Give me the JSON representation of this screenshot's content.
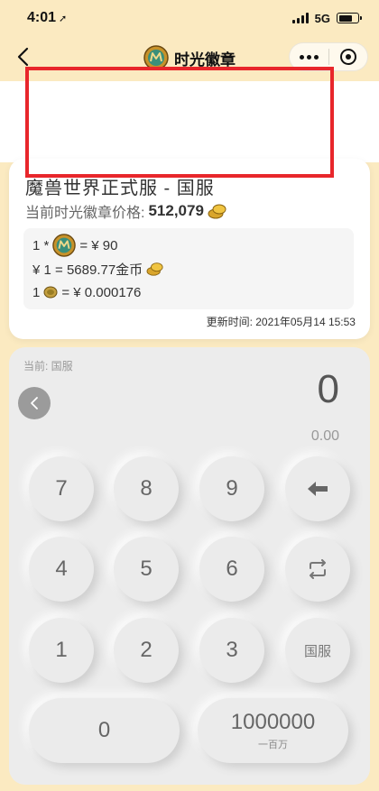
{
  "status_bar": {
    "time": "4:01",
    "network": "5G"
  },
  "nav": {
    "title": "时光徽章"
  },
  "price_card": {
    "server_name": "魔兽世界正式服 - 国服",
    "price_label": "当前时光徽章价格:",
    "price_value": "512,079",
    "rate1_prefix": "1 *",
    "rate1_value": "= ¥ 90",
    "rate2": "¥ 1 = 5689.77金币",
    "rate3_prefix": "1",
    "rate3_value": "= ¥ 0.000176",
    "updated": "更新时间:  2021年05月14  15:53"
  },
  "calculator": {
    "current_label": "当前: 国服",
    "display_value": "0",
    "display_sub": "0.00",
    "keys": {
      "k7": "7",
      "k8": "8",
      "k9": "9",
      "k4": "4",
      "k5": "5",
      "k6": "6",
      "k1": "1",
      "k2": "2",
      "k3": "3",
      "region": "国服",
      "k0": "0",
      "million": "1000000",
      "million_sub": "一百万"
    }
  },
  "colors": {
    "background": "#fbeac1",
    "highlight_box": "#e8262b",
    "coin": "#d9a52b"
  },
  "icons": [
    "back-arrow-icon",
    "badge-token-icon",
    "more-dots-icon",
    "target-icon",
    "gold-coins-icon",
    "copper-coin-icon",
    "chevron-left-icon",
    "backspace-icon",
    "swap-icon"
  ]
}
